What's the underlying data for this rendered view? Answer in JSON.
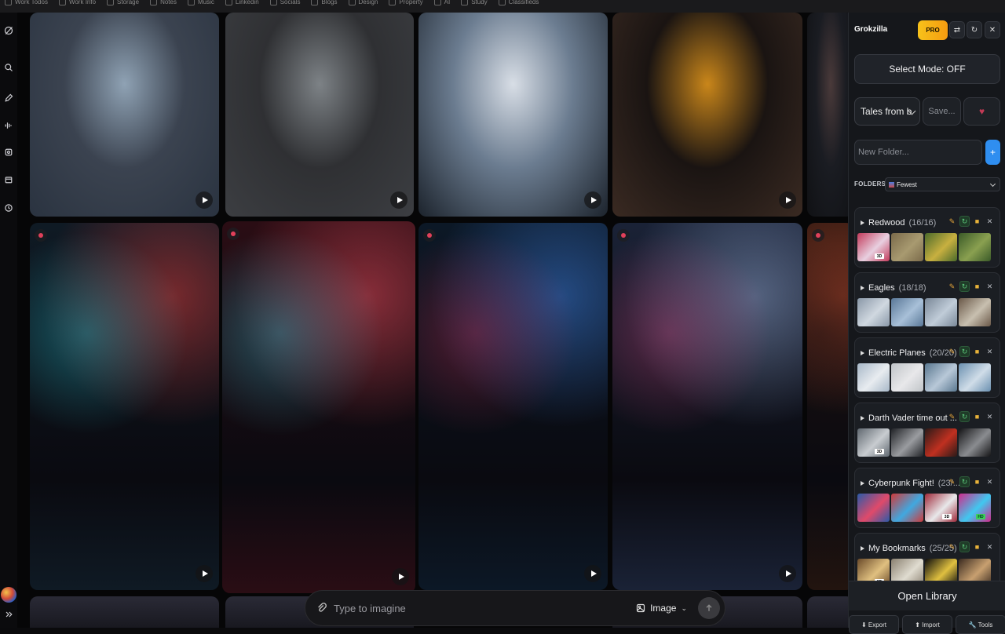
{
  "topbar": {
    "bookmarks": [
      "Work Todos",
      "Work Info",
      "Storage",
      "Notes",
      "Music",
      "Linkedin",
      "Socials",
      "Blogs",
      "Design",
      "Property",
      "AI",
      "Study",
      "Classifieds"
    ]
  },
  "rail": {
    "icons": [
      "grok-logo-icon",
      "search-icon",
      "edit-icon",
      "voice-icon",
      "imagine-icon",
      "projects-icon",
      "history-icon",
      "expand-icon"
    ]
  },
  "grid": {
    "tiles": [
      {
        "colors": [
          "#3b4350",
          "#8fa2b4",
          "#2a3340"
        ],
        "play": true,
        "pin": false
      },
      {
        "colors": [
          "#2f3033",
          "#7d8286",
          "#3c3e42"
        ],
        "play": true,
        "pin": false
      },
      {
        "colors": [
          "#6b7c90",
          "#d8dee6",
          "#1c232c"
        ],
        "play": true,
        "pin": false
      },
      {
        "colors": [
          "#1a1412",
          "#c9861a",
          "#3a2a22"
        ],
        "play": true,
        "pin": false
      },
      {
        "colors": [
          "#1a1c22",
          "#4a3a3a",
          "#101114"
        ],
        "play": false,
        "pin": false
      },
      {
        "colors": [
          "#0f1a24",
          "#d23a3a",
          "#2de0f0"
        ],
        "play": true,
        "pin": true
      },
      {
        "colors": [
          "#2a0d14",
          "#e04a5a",
          "#40d8f0"
        ],
        "play": true,
        "pin": true
      },
      {
        "colors": [
          "#0c1826",
          "#3a7ad8",
          "#e0305a"
        ],
        "play": true,
        "pin": true
      },
      {
        "colors": [
          "#1a2236",
          "#8aa0c8",
          "#e84a8a"
        ],
        "play": true,
        "pin": true
      },
      {
        "colors": [
          "#22140f",
          "#d05030",
          "#0c0c10"
        ],
        "play": false,
        "pin": true
      }
    ]
  },
  "prompt": {
    "placeholder": "Type to imagine",
    "mode_label": "Image"
  },
  "panel": {
    "title": "Grokzilla",
    "pro_label": "PRO",
    "icon_buttons": [
      "⇄",
      "↻",
      "✕"
    ],
    "select_mode_label": "Select Mode: OFF",
    "collection_value": "Tales from b",
    "save_label": "Save...",
    "heart": "♥",
    "new_folder_placeholder": "New Folder...",
    "add_label": "+",
    "folders_label": "FOLDERS",
    "sort_value": "Fewest",
    "folders": [
      {
        "name": "Redwood",
        "count": "(16/16)",
        "thumbs": [
          [
            "#c23a5a",
            "#e8d0e0"
          ],
          [
            "#7a6a4a",
            "#a89a70"
          ],
          [
            "#4a6a2a",
            "#c8b040"
          ],
          [
            "#3a5a28",
            "#8aa050"
          ]
        ],
        "tags": [
          "3D",
          "",
          "",
          ""
        ]
      },
      {
        "name": "Eagles",
        "count": "(18/18)",
        "thumbs": [
          [
            "#8a98a8",
            "#d0d8e0"
          ],
          [
            "#5a7898",
            "#a8c0d8"
          ],
          [
            "#7a8898",
            "#c0ccd8"
          ],
          [
            "#6a5848",
            "#c8c0b0"
          ]
        ],
        "tags": [
          "",
          "",
          "",
          ""
        ]
      },
      {
        "name": "Electric Planes",
        "count": "(20/20)",
        "thumbs": [
          [
            "#a8b8c8",
            "#e8ecf0"
          ],
          [
            "#c0c4c8",
            "#e8e8ea"
          ],
          [
            "#5a7890",
            "#b8c8d8"
          ],
          [
            "#6a90b0",
            "#d0dde8"
          ]
        ],
        "tags": [
          "",
          "",
          "",
          ""
        ]
      },
      {
        "name": "Darth Vader time out ...",
        "count": "",
        "thumbs": [
          [
            "#606870",
            "#c8ccd0"
          ],
          [
            "#202226",
            "#9a9ca0"
          ],
          [
            "#2a1a18",
            "#c03020"
          ],
          [
            "#141416",
            "#8a8c90"
          ]
        ],
        "tags": [
          "3D",
          "",
          "",
          ""
        ]
      },
      {
        "name": "Cyberpunk Fight!",
        "count": "(23/...",
        "thumbs": [
          [
            "#2a5aa8",
            "#e04a6a"
          ],
          [
            "#d03a3a",
            "#40a8e0"
          ],
          [
            "#a02a3a",
            "#e8e8ea"
          ],
          [
            "#d02a8a",
            "#40c8f0"
          ]
        ],
        "tags": [
          "",
          "",
          "3D",
          "HD"
        ]
      },
      {
        "name": "My Bookmarks",
        "count": "(25/25)",
        "thumbs": [
          [
            "#6a4a2a",
            "#e0c080"
          ],
          [
            "#8a8070",
            "#e0dcd0"
          ],
          [
            "#0a0a0c",
            "#e0c040"
          ],
          [
            "#3a2a20",
            "#c8a070"
          ]
        ],
        "tags": [
          "3D",
          "",
          "",
          ""
        ]
      }
    ],
    "open_library_label": "Open Library",
    "footer_buttons": [
      "⬇ Export",
      "⬆ Import",
      "🔧 Tools"
    ]
  }
}
